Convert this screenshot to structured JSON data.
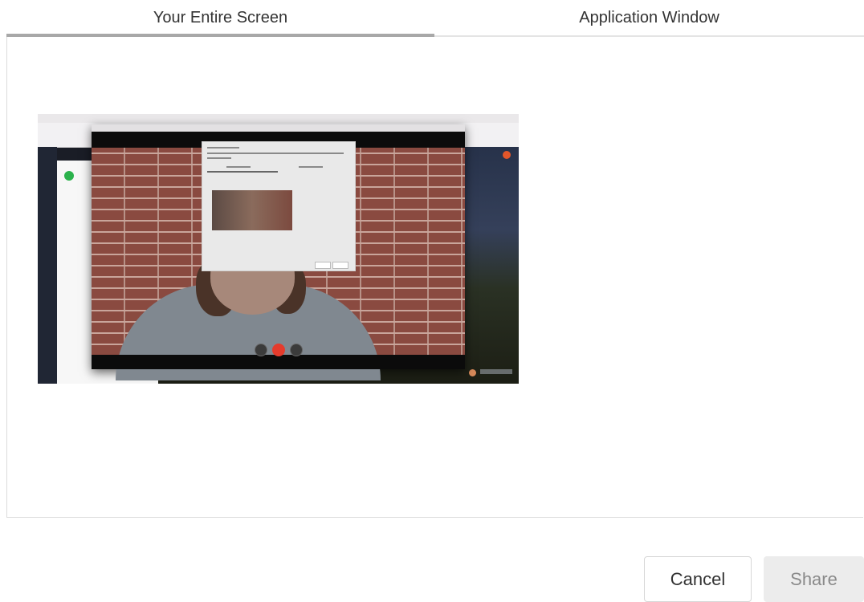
{
  "tabs": {
    "entire_screen": "Your Entire Screen",
    "application_window": "Application Window",
    "selected": "Your Entire Screen"
  },
  "buttons": {
    "cancel": "Cancel",
    "share": "Share",
    "share_enabled": false
  },
  "colors": {
    "tab_underline": "#a8a8a8",
    "share_disabled_bg": "#ececec",
    "end_call_red": "#e53b2c"
  }
}
